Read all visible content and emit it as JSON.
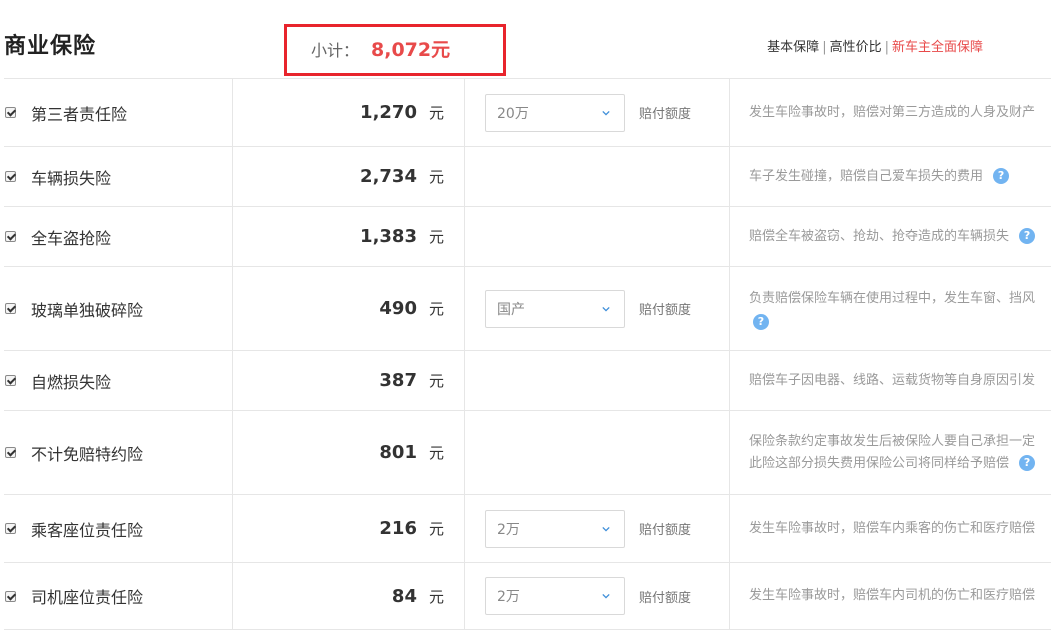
{
  "header": {
    "title": "商业保险",
    "subtotal_label": "小计：",
    "subtotal_value": "8,072元",
    "plans": [
      "基本保障",
      "高性价比",
      "新车主全面保障"
    ]
  },
  "unit": "元",
  "option_label": "赔付额度",
  "rows": [
    {
      "name": "第三者责任险",
      "price": "1,270",
      "option": "20万",
      "desc": [
        "发生车险事故时，赔偿对第三方造成的人身及财产"
      ],
      "help": false
    },
    {
      "name": "车辆损失险",
      "price": "2,734",
      "option": "",
      "desc": [
        "车子发生碰撞，赔偿自己爱车损失的费用"
      ],
      "help": true
    },
    {
      "name": "全车盗抢险",
      "price": "1,383",
      "option": "",
      "desc": [
        "赔偿全车被盗窃、抢劫、抢夺造成的车辆损失"
      ],
      "help": true
    },
    {
      "name": "玻璃单独破碎险",
      "price": "490",
      "option": "国产",
      "desc": [
        "负责赔偿保险车辆在使用过程中，发生车窗、挡风"
      ],
      "help": true
    },
    {
      "name": "自燃损失险",
      "price": "387",
      "option": "",
      "desc": [
        "赔偿车子因电器、线路、运载货物等自身原因引发"
      ],
      "help": false
    },
    {
      "name": "不计免赔特约险",
      "price": "801",
      "option": "",
      "desc": [
        "保险条款约定事故发生后被保险人要自己承担一定",
        "此险这部分损失费用保险公司将同样给予赔偿"
      ],
      "help": true
    },
    {
      "name": "乘客座位责任险",
      "price": "216",
      "option": "2万",
      "desc": [
        "发生车险事故时，赔偿车内乘客的伤亡和医疗赔偿"
      ],
      "help": false
    },
    {
      "name": "司机座位责任险",
      "price": "84",
      "option": "2万",
      "desc": [
        "发生车险事故时，赔偿车内司机的伤亡和医疗赔偿"
      ],
      "help": false
    }
  ],
  "colors": {
    "accent_red": "#e84a4a",
    "box_red": "#e8242c",
    "help_blue": "#72b4f1"
  }
}
